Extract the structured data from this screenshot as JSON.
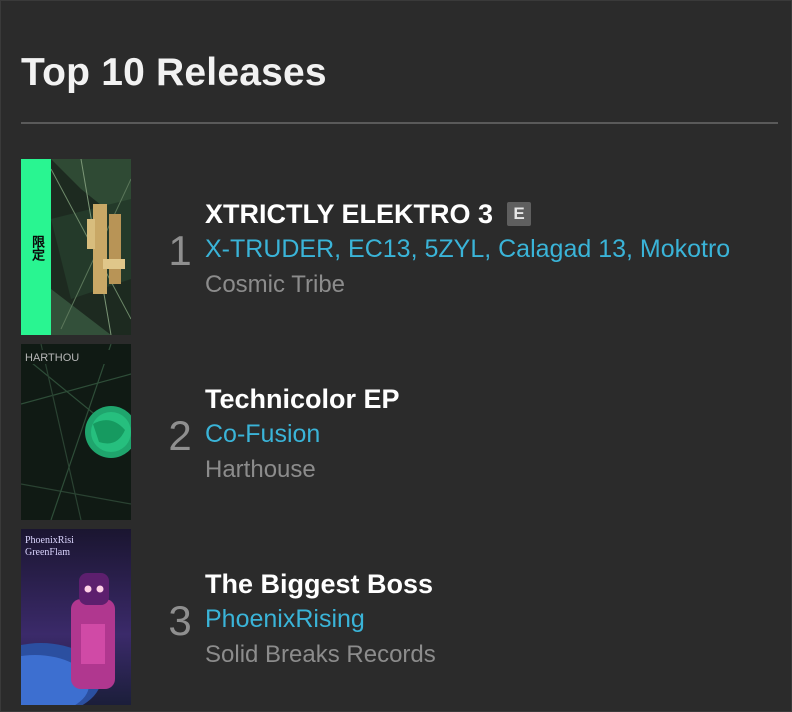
{
  "heading": "Top 10 Releases",
  "colors": {
    "background": "#2b2b2b",
    "artist_link": "#3ab4d8",
    "label_text": "#8c8c8c",
    "exclusive_badge": "#29f591"
  },
  "releases": [
    {
      "rank": "1",
      "title": "XTRICTLY ELEKTRO 3",
      "explicit_badge": "E",
      "artists": "X-TRUDER, EC13, 5ZYL, Calagad 13, Mokotro",
      "label": "Cosmic Tribe",
      "exclusive_tag": "限定"
    },
    {
      "rank": "2",
      "title": "Technicolor EP",
      "artists": "Co-Fusion",
      "label": "Harthouse"
    },
    {
      "rank": "3",
      "title": "The Biggest Boss",
      "artists": "PhoenixRising",
      "label": "Solid Breaks Records"
    }
  ]
}
